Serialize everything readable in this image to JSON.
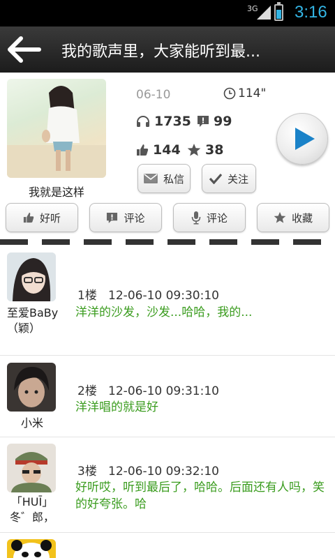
{
  "status_bar": {
    "network": "3G",
    "time": "3:16"
  },
  "title_bar": {
    "title": "我的歌声里，大家能听到最..."
  },
  "song": {
    "singer_name": "我就是这样",
    "date": "06-10",
    "duration": "114\"",
    "listens": "1735",
    "comments": "99",
    "likes": "144",
    "favorites": "38"
  },
  "header_buttons": {
    "message": "私信",
    "follow": "关注"
  },
  "action_buttons": [
    {
      "label": "好听",
      "icon": "thumbs-up-icon"
    },
    {
      "label": "评论",
      "icon": "comment-icon"
    },
    {
      "label": "评论",
      "icon": "microphone-icon"
    },
    {
      "label": "收藏",
      "icon": "star-icon"
    }
  ],
  "comments": [
    {
      "user": "至爱BaBy（颖）",
      "floor": "1楼",
      "time": "12-06-10 09:30:10",
      "text": "洋洋的沙发，沙发...哈哈，我的..."
    },
    {
      "user": "小米",
      "floor": "2楼",
      "time": "12-06-10 09:31:10",
      "text": "洋洋唱的就是好"
    },
    {
      "user": "「HUĪ」冬゛郎，",
      "floor": "3楼",
      "time": "12-06-10 09:32:10",
      "text": "好听哎，听到最后了，哈哈。后面还有人吗，笑的好夸张。哈"
    }
  ],
  "colors": {
    "accent": "#33b5e5",
    "comment_text": "#3a9c1e",
    "play": "#1a82c8"
  }
}
